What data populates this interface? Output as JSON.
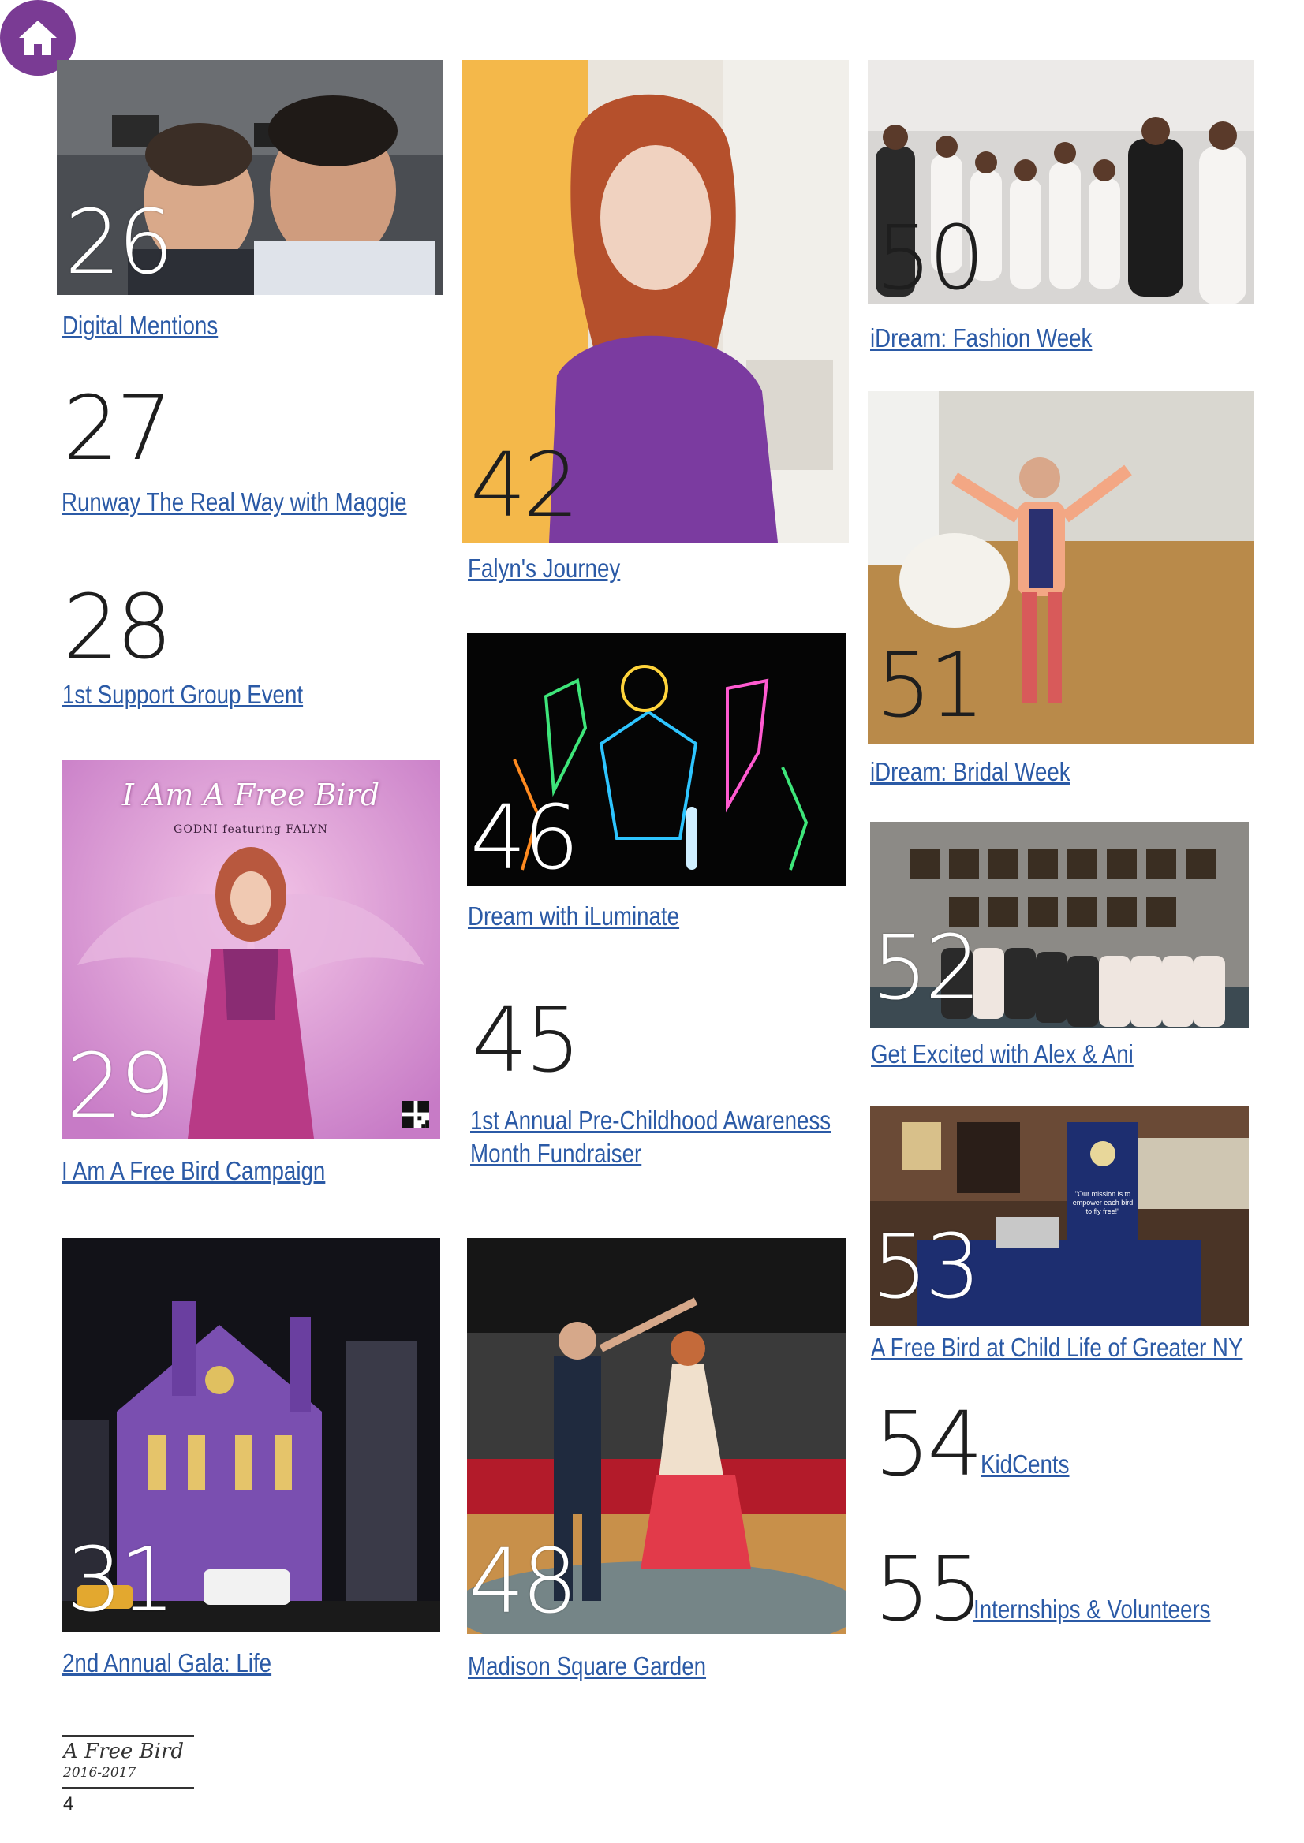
{
  "toc": [
    {
      "page": "26",
      "title": "Digital Mentions"
    },
    {
      "page": "27",
      "title": "Runway The Real Way with Maggie"
    },
    {
      "page": "28",
      "title": "1st Support Group Event"
    },
    {
      "page": "29",
      "title": "I Am A Free Bird Campaign"
    },
    {
      "page": "31",
      "title": "2nd Annual Gala: Life"
    },
    {
      "page": "42",
      "title": "Falyn's Journey"
    },
    {
      "page": "46",
      "title": "Dream with iLuminate"
    },
    {
      "page": "45",
      "title": "1st Annual Pre-Childhood Awareness",
      "title2": "Month Fundraiser"
    },
    {
      "page": "48",
      "title": "Madison Square Garden"
    },
    {
      "page": "50",
      "title": "iDream: Fashion Week"
    },
    {
      "page": "51",
      "title": "iDream: Bridal Week"
    },
    {
      "page": "52",
      "title": "Get Excited with Alex & Ani"
    },
    {
      "page": "53",
      "title": "A Free Bird at Child Life of Greater NY"
    },
    {
      "page": "54",
      "title": "KidCents"
    },
    {
      "page": "55",
      "title": "Internships & Volunteers"
    }
  ],
  "poster": {
    "title": "I Am A Free Bird",
    "subtitle": "GODNI featuring FALYN"
  },
  "banner": {
    "text": "\"Our mission is to empower each bird to fly free!\""
  },
  "footer": {
    "title": "A Free Bird",
    "years": "2016-2017",
    "page_number": "4"
  },
  "colors": {
    "frame": "#9b4fb0",
    "link": "#2b5aa6",
    "home_button": "#7a3b94"
  },
  "icons": {
    "home": "home-icon"
  }
}
